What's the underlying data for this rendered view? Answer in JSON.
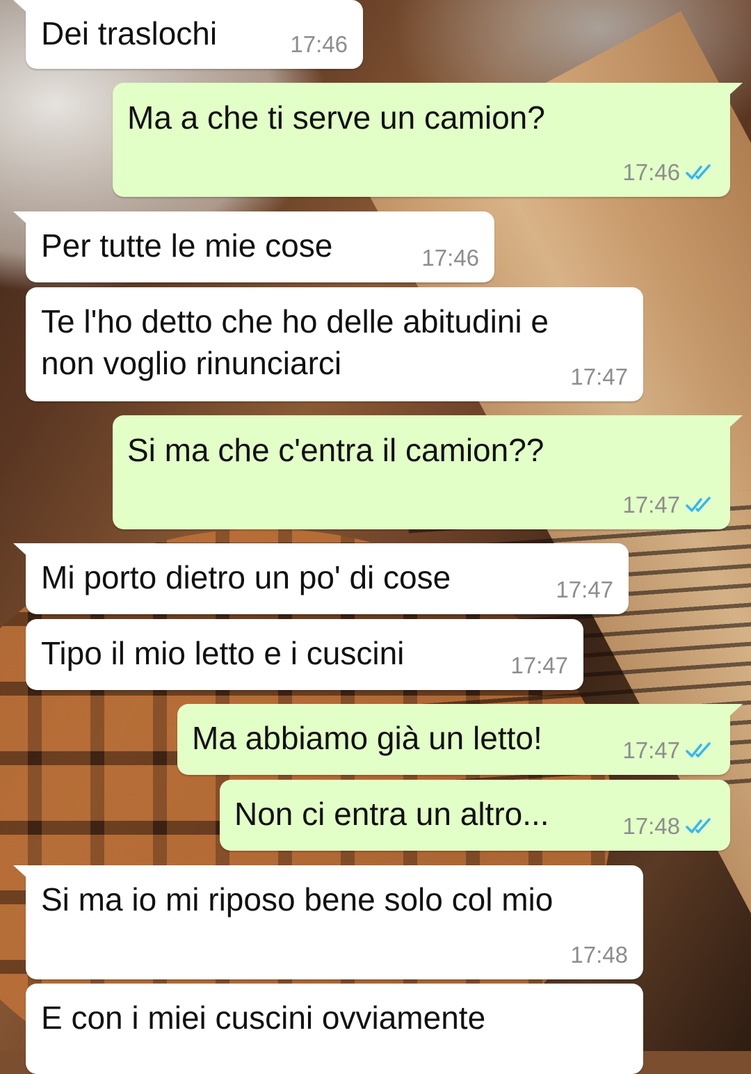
{
  "messages": [
    {
      "dir": "in",
      "text": "Dei traslochi",
      "time": "17:46"
    },
    {
      "dir": "out",
      "text": "Ma a che ti serve un camion?",
      "time": "17:46",
      "read": true
    },
    {
      "dir": "in",
      "text": "Per tutte le mie cose",
      "time": "17:46"
    },
    {
      "dir": "in",
      "text": "Te l'ho detto che ho delle abitudini e\nnon voglio rinunciarci",
      "time": "17:47"
    },
    {
      "dir": "out",
      "text": "Si ma che c'entra il camion??",
      "time": "17:47",
      "read": true
    },
    {
      "dir": "in",
      "text": "Mi porto dietro un po' di cose",
      "time": "17:47"
    },
    {
      "dir": "in",
      "text": "Tipo il mio letto e i cuscini",
      "time": "17:47"
    },
    {
      "dir": "out",
      "text": "Ma abbiamo già un letto!",
      "time": "17:47",
      "read": true
    },
    {
      "dir": "out",
      "text": "Non ci entra un altro...",
      "time": "17:48",
      "read": true
    },
    {
      "dir": "in",
      "text": "Si ma io mi riposo bene solo col mio",
      "time": "17:48"
    },
    {
      "dir": "in",
      "text": "E con i miei cuscini ovviamente",
      "time": ""
    }
  ],
  "colors": {
    "incoming_bubble": "#ffffff",
    "outgoing_bubble": "#e2ffc7",
    "read_ticks": "#34b7f1",
    "timestamp": "#8d8d8d"
  },
  "icons": {
    "read_receipt": "double-check-icon"
  }
}
